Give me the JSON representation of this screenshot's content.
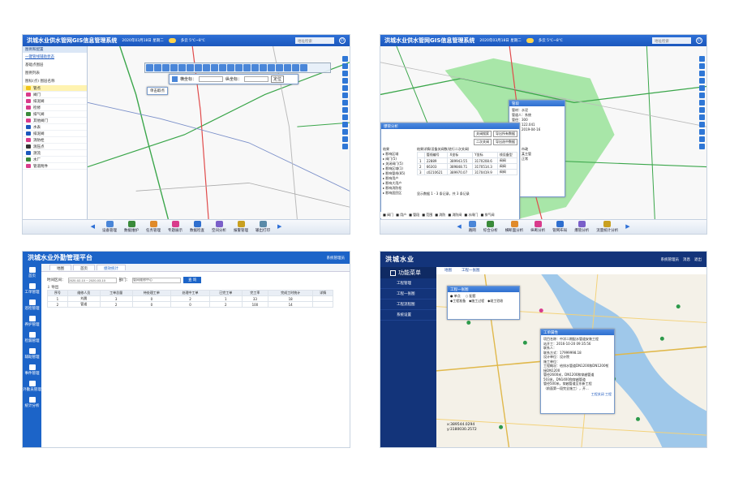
{
  "gis": {
    "title": "洪城水业供水管网GIS信息管理系统",
    "datetime": "2020年03月18日 星期二",
    "weather": "多云 5℃~8℃",
    "search_placeholder": "地址检索",
    "sidebar": {
      "header": "图例和配置",
      "tab_link": "一键管线辅助状态",
      "layer_label": "基础点图层",
      "legend_label": "图例列表",
      "edit_label": "图标(点) 图层名称",
      "items": [
        {
          "label": "管点",
          "color": "#f0c419"
        },
        {
          "label": "阀门",
          "color": "#d93b8c"
        },
        {
          "label": "排泥阀",
          "color": "#d93b8c"
        },
        {
          "label": "检修",
          "color": "#d93b8c"
        },
        {
          "label": "排气阀",
          "color": "#3a8a3a"
        },
        {
          "label": "其他阀门",
          "color": "#d93b8c"
        },
        {
          "label": "水表",
          "color": "#1b57bd"
        },
        {
          "label": "排泥阀",
          "color": "#1b57bd"
        },
        {
          "label": "消防栓",
          "color": "#d93b8c"
        },
        {
          "label": "测压点",
          "color": "#333"
        },
        {
          "label": "测流",
          "color": "#1b57bd"
        },
        {
          "label": "水厂",
          "color": "#3a8a3a"
        },
        {
          "label": "管道附件",
          "color": "#d93b8c"
        }
      ]
    },
    "toolbar": {
      "input1_label": "横坐标：",
      "input2_label": "纵坐标：",
      "locate_button": "定位",
      "tooltip": "单击取点"
    },
    "bottom_tabs": [
      "设备管理",
      "数据维护",
      "任务管理",
      "专题展示",
      "数据检查",
      "空间分析",
      "报警管理",
      "输出打印"
    ]
  },
  "gis2": {
    "title": "洪城水业供水管网GIS信息管理系统",
    "datetime": "2020年03月18日 星期二",
    "weather": "多云 5℃~8℃",
    "search_placeholder": "地址检索",
    "info_popup": {
      "title": "管段",
      "lines": [
        "管材：水泥",
        "管道人：系统",
        "管径：300",
        "管长：122.041",
        "日期：2019-04-16",
        "口径：",
        "埋深：",
        "材质：",
        "类型：市政",
        "权属：某主管",
        "状态：正常",
        "地址："
      ]
    },
    "analysis": {
      "title": "爆管分析",
      "btn1": "关阀搜索",
      "btn2": "导出所有数据",
      "btn3": "二次关阀",
      "btn4": "导出选中数据",
      "left_title": "结果",
      "result_title": "结果详情(设备关阀数/进行二次关阀)",
      "tree": [
        "影响区域",
        "阀门(5)",
        "关闭阀门(5)",
        "影响区域(1)",
        "影响管线(85)",
        "影响用户",
        "影响大用户",
        "影响消防栓",
        "影响居民区"
      ],
      "columns": [
        "",
        "管线编号",
        "X坐标",
        "Y坐标",
        "线设备型"
      ],
      "rows": [
        [
          "1",
          "22889",
          "389943.55",
          "3170208.6",
          "阀阀"
        ],
        [
          "2",
          "66303",
          "389848.71",
          "3170514.3",
          "阀阀"
        ],
        [
          "3",
          "c0210621",
          "389970.07",
          "3170419.9",
          "阀阀"
        ]
      ],
      "pager": "显示数据 1 - 3 条记录，共 3 条记录"
    },
    "legend": [
      "阀门",
      "用户",
      "管段",
      "范围",
      "消防",
      "消防阀",
      "水闸门",
      "排气阀"
    ],
    "bottom_tabs": [
      "路网",
      "综合分析",
      "横断面分析",
      "纵断分析",
      "管网布局",
      "爆管分析",
      "流量统计分析"
    ]
  },
  "outwork": {
    "title": "洪城水业外勤管理平台",
    "user": "系统管理员",
    "nav": [
      "首页",
      "工单管理",
      "巡检管理",
      "养护管理",
      "检漏管理",
      "辅助管理",
      "事件管理",
      "外勤员管理",
      "统计分析"
    ],
    "tabs": [
      "地图",
      "首页",
      "绩效统计"
    ],
    "filter": {
      "time_label": "时间区间：",
      "time_value": "2020-02-10 ~ 2020-03-10",
      "dept_label": "部门：",
      "dept_value": "管网维修中心",
      "query_button": "查 询"
    },
    "export_label": "⇩ 导出",
    "columns": [
      "序号",
      "维修人员",
      "工单总量",
      "待处理工单",
      "处理中工单",
      "已完工单",
      "完工率",
      "完成工时统计",
      "详情"
    ],
    "rows": [
      [
        "1",
        "刘晨",
        "3",
        "0",
        "2",
        "1",
        "33",
        "18",
        ""
      ],
      [
        "2",
        "管道",
        "2",
        "0",
        "0",
        "2",
        "100",
        "14",
        ""
      ]
    ]
  },
  "hongcheng": {
    "brand": "洪城水业",
    "user": "系统管理员",
    "msg": "消息",
    "logout": "退出",
    "menu_title": "功能菜单",
    "menu": [
      "工程管理",
      "工程一张图",
      "工程流程图",
      "系统设置"
    ],
    "tabs": [
      "地图",
      "工程一张图"
    ],
    "panel1": {
      "title": "工程一张图",
      "opt1": "单点",
      "opt2": "配套",
      "legend": [
        "工程准备",
        "施工过程",
        "竣工验收"
      ]
    },
    "panel2": {
      "title": "工单属性",
      "lines": [
        "项目名称：中洋二期配水管道安装工程",
        "站开工：2016-10-20 09:35:56",
        "联系人：",
        "联系方式：17999998.18",
        "设计单位：设计院",
        "施工单位：",
        "工程概况：给排水管道DN1200和DN1200衔接DN1200",
        "管径2600米，DN1200和穿越管道",
        "503米，DN1400和穿越管道",
        "管径500米，穿越管道至东新工程",
        "（前面第一段完全施工），开..."
      ],
      "footer": "工程关闭 工程"
    },
    "coords": [
      "x:389544.0294",
      "y:3180030.2572"
    ]
  }
}
